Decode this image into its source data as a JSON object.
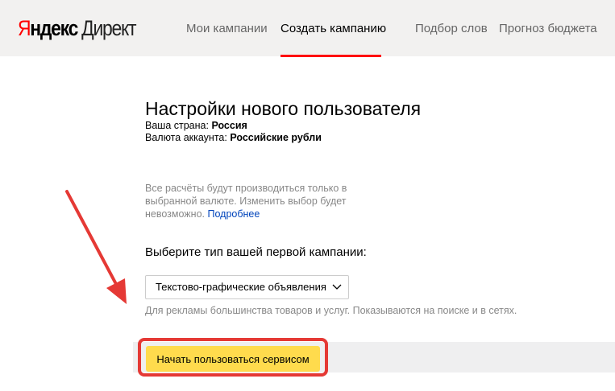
{
  "header": {
    "logo_prefix": "Я",
    "logo_rest": "ндекс",
    "logo_product": "Директ",
    "nav": [
      {
        "label": "Мои кампании"
      },
      {
        "label": "Создать кампанию",
        "active": true
      },
      {
        "label": "Подбор слов"
      },
      {
        "label": "Прогноз бюджета"
      }
    ]
  },
  "main": {
    "title": "Настройки нового пользователя",
    "country_label": "Ваша страна:",
    "country_value": "Россия",
    "currency_label": "Валюта аккаунта:",
    "currency_value": "Российские рубли",
    "note": "Все расчёты будут производиться только в выбранной валюте. Изменить выбор будет невозможно.",
    "note_link": "Подробнее",
    "campaign_question": "Выберите тип вашей первой кампании:",
    "campaign_type": "Текстово-графические объявления",
    "campaign_hint": "Для рекламы большинства товаров и услуг. Показываются на поиске и в сетях.",
    "start_button": "Начать пользоваться сервисом"
  },
  "colors": {
    "accent": "#ffdb4d",
    "annotation": "#e53935",
    "active_tab": "#ff0000"
  }
}
